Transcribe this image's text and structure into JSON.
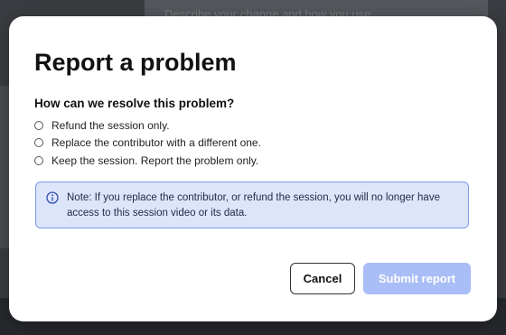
{
  "background": {
    "panel_text": "Describe your change and how you use"
  },
  "modal": {
    "title": "Report a problem",
    "question": "How can we resolve this problem?",
    "options": [
      {
        "label": "Refund the session only.",
        "selected": false
      },
      {
        "label": "Replace the contributor with a different one.",
        "selected": false
      },
      {
        "label": "Keep the session. Report the problem only.",
        "selected": false
      }
    ],
    "note": {
      "icon": "info-icon",
      "text": "Note: If you replace the contributor, or refund the session, you will no longer have access to this session video or its data."
    },
    "buttons": {
      "cancel_label": "Cancel",
      "submit_label": "Submit report",
      "submit_disabled": true
    }
  },
  "colors": {
    "note_background": "#dde5fb",
    "note_border": "#7a9be6",
    "submit_disabled": "#a9bdf6"
  }
}
